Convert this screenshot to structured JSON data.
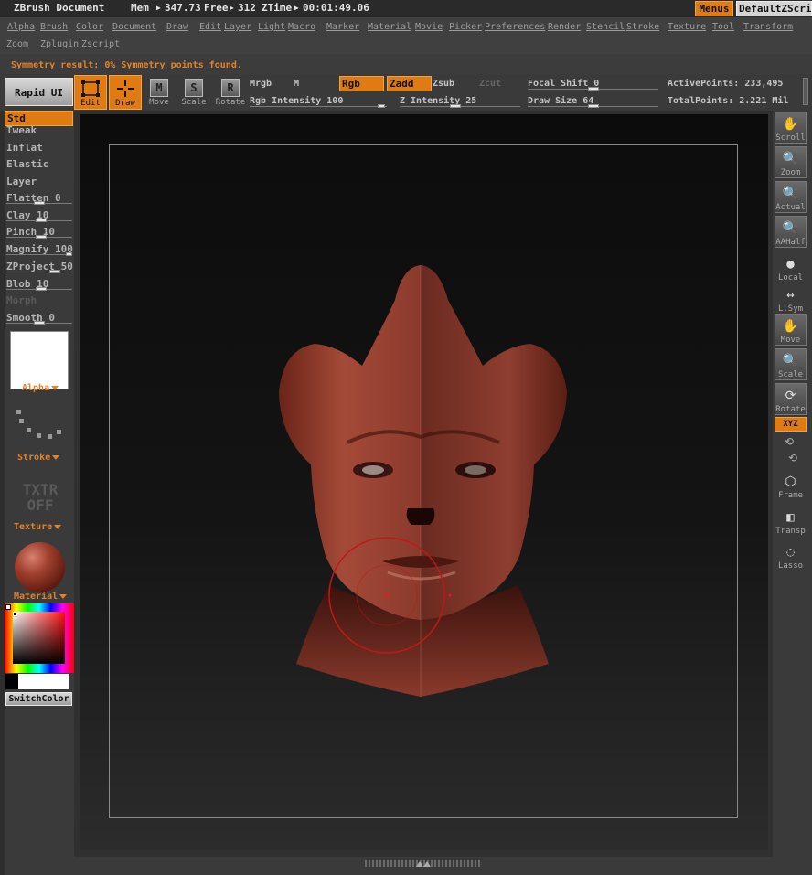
{
  "titlebar": {
    "app": "ZBrush Document",
    "mem_label": "Mem",
    "mem_value": "347.73",
    "free_label": "Free",
    "free_value": "312",
    "ztime_label": "ZTime",
    "ztime_value": "00:01:49.06",
    "menus_btn": "Menus",
    "zscript_btn": "DefaultZScript"
  },
  "menus": [
    "Alpha",
    "Brush",
    "Color",
    "Document",
    "Draw",
    "Edit",
    "Layer",
    "Light",
    "Macro",
    "Marker",
    "Material",
    "Movie",
    "Picker",
    "Preferences",
    "Render",
    "Stencil",
    "Stroke",
    "Texture",
    "Tool",
    "Transform",
    "Zoom",
    "Zplugin",
    "Zscript"
  ],
  "status": "Symmetry result: 0% Symmetry points found.",
  "toolbar": {
    "rapid_ui": "Rapid UI",
    "edit": "Edit",
    "draw": "Draw",
    "move": "Move",
    "scale": "Scale",
    "rotate": "Rotate",
    "move_glyph": "M",
    "scale_glyph": "S",
    "rotate_glyph": "R",
    "mrgb": "Mrgb",
    "m": "M",
    "rgb": "Rgb",
    "zadd": "Zadd",
    "zsub": "Zsub",
    "zcut": "Zcut",
    "rgb_intensity": "Rgb Intensity 100",
    "z_intensity": "Z Intensity 25",
    "focal_shift": "Focal Shift 0",
    "draw_size": "Draw Size 64",
    "active_points": "ActivePoints: 233,495",
    "total_points": "TotalPoints: 2.221 Mil"
  },
  "brushes": [
    {
      "label": "Std",
      "state": "selected"
    },
    {
      "label": "Tweak",
      "state": "normal"
    },
    {
      "label": "Inflat",
      "state": "normal"
    },
    {
      "label": "Elastic",
      "state": "normal"
    },
    {
      "label": "Layer",
      "state": "normal"
    },
    {
      "label": "Flatten 0",
      "state": "normal"
    },
    {
      "label": "Clay 10",
      "state": "normal"
    },
    {
      "label": "Pinch 10",
      "state": "normal"
    },
    {
      "label": "Magnify 100",
      "state": "normal"
    },
    {
      "label": "ZProject 50",
      "state": "normal"
    },
    {
      "label": "Blob 10",
      "state": "normal"
    },
    {
      "label": "Morph",
      "state": "disabled"
    },
    {
      "label": "Smooth 0",
      "state": "normal"
    }
  ],
  "leftpanel": {
    "alpha": "Alpha",
    "stroke": "Stroke",
    "txtr": "TXTR OFF",
    "texture": "Texture",
    "material": "Material",
    "switch_color": "SwitchColor",
    "primary_color": "#ff1010",
    "secondary_color": "#ffffff"
  },
  "rightpanel": {
    "scroll": "Scroll",
    "zoom": "Zoom",
    "actual": "Actual",
    "aahalf": "AAHalf",
    "local": "Local",
    "lsym": "L.Sym",
    "move": "Move",
    "scale": "Scale",
    "rotate": "Rotate",
    "xyz": "XYZ",
    "frame": "Frame",
    "transp": "Transp",
    "lasso": "Lasso"
  },
  "colors": {
    "accent": "#e07a12",
    "model": "#8a3a2c",
    "brush_ring": "#c01818"
  }
}
